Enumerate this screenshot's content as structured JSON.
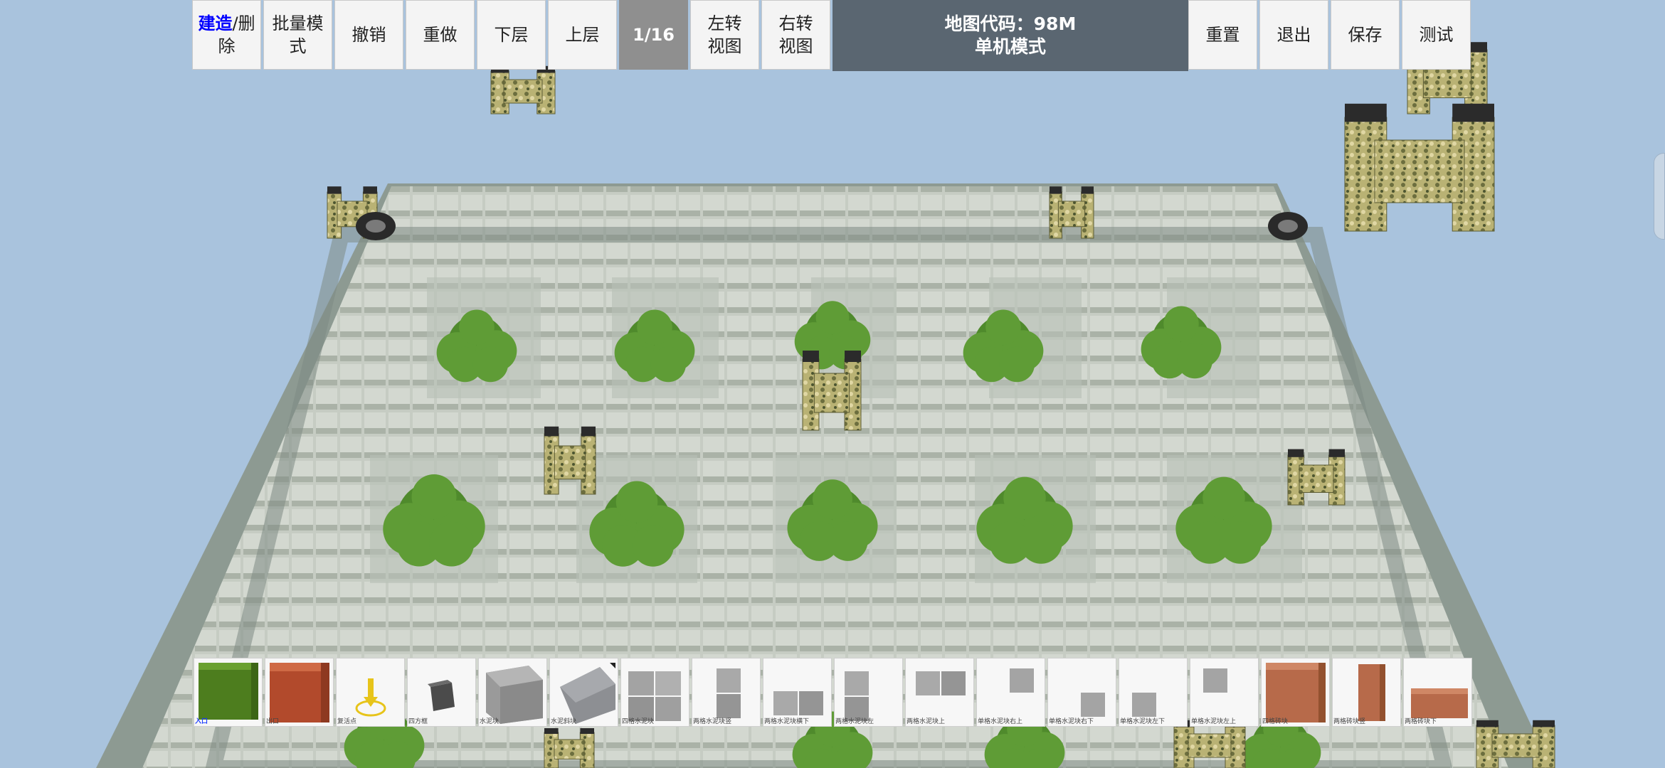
{
  "toolbar": {
    "build_delete": {
      "highlight": "建造",
      "sep": "/",
      "rest_line1": "删",
      "rest_line2": "除"
    },
    "batch_mode": {
      "line1": "批量模",
      "line2": "式"
    },
    "undo": "撤销",
    "redo": "重做",
    "layer_down": "下层",
    "layer_up": "上层",
    "level_indicator": "1/16",
    "rotate_left": {
      "line1": "左转",
      "line2": "视图"
    },
    "rotate_right": {
      "line1": "右转",
      "line2": "视图"
    },
    "reset": "重置",
    "exit": "退出",
    "save": "保存",
    "test": "测试"
  },
  "map_info": {
    "code_line": "地图代码：98M",
    "mode_line": "单机模式"
  },
  "palette": {
    "items": [
      {
        "label": "入口",
        "icon": "grass-block-icon",
        "label_color": "#1b3cff"
      },
      {
        "label": "出口",
        "icon": "brick-block-icon"
      },
      {
        "label": "复活点",
        "icon": "spawn-point-icon"
      },
      {
        "label": "四方框",
        "icon": "dark-cube-icon"
      },
      {
        "label": "水泥块",
        "icon": "concrete-block-icon"
      },
      {
        "label": "水泥斜块",
        "icon": "concrete-slope-icon"
      },
      {
        "label": "四格水泥块",
        "icon": "four-concrete-block-icon"
      },
      {
        "label": "两格水泥块竖",
        "icon": "two-concrete-block-vertical-icon"
      },
      {
        "label": "两格水泥块横下",
        "icon": "two-concrete-block-horizontal-down-icon"
      },
      {
        "label": "两格水泥块左",
        "icon": "two-concrete-block-left-icon"
      },
      {
        "label": "两格水泥块上",
        "icon": "two-concrete-block-up-icon"
      },
      {
        "label": "单格水泥块右上",
        "icon": "single-concrete-top-right-icon"
      },
      {
        "label": "单格水泥块右下",
        "icon": "single-concrete-bottom-right-icon"
      },
      {
        "label": "单格水泥块左下",
        "icon": "single-concrete-bottom-left-icon"
      },
      {
        "label": "单格水泥块左上",
        "icon": "single-concrete-top-left-icon"
      },
      {
        "label": "四格砖块",
        "icon": "four-brick-block-icon"
      },
      {
        "label": "两格砖块竖",
        "icon": "two-brick-block-vertical-icon"
      },
      {
        "label": "两格砖块下",
        "icon": "two-brick-block-down-icon"
      }
    ]
  },
  "colors": {
    "sky": "#a9c3dd",
    "toolbar_bg": "#f4f4f4",
    "map_info_bg": "#5a6671",
    "level_bg": "#8f8f8f",
    "highlight_text": "#0000ff",
    "concrete": "#c9d0c6",
    "bush": "#4f8a2c",
    "camo": "#a9a563"
  }
}
